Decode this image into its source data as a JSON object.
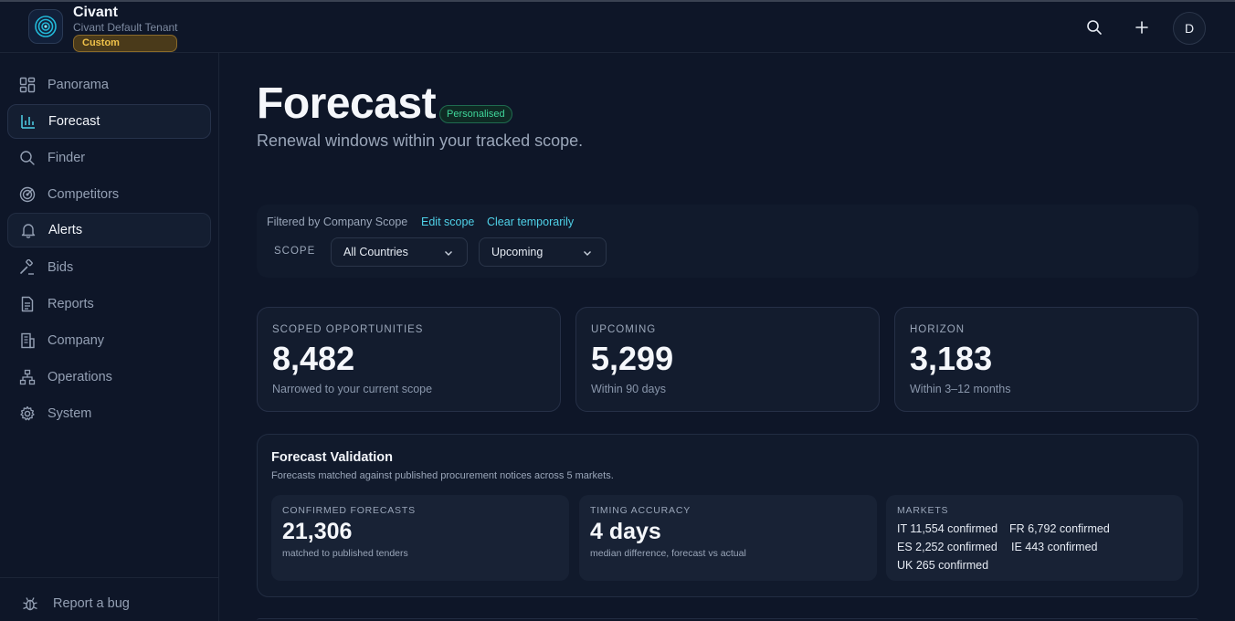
{
  "brand": {
    "name": "Civant",
    "tenant": "Civant Default Tenant",
    "badge": "Custom"
  },
  "header": {
    "avatar_initial": "D",
    "search_icon": "search-icon",
    "add_icon": "plus-icon"
  },
  "sidebar": {
    "items": [
      {
        "label": "Panorama",
        "icon": "grid-icon"
      },
      {
        "label": "Forecast",
        "icon": "bar-chart-icon",
        "active": true
      },
      {
        "label": "Finder",
        "icon": "search-icon"
      },
      {
        "label": "Competitors",
        "icon": "target-icon"
      },
      {
        "label": "Alerts",
        "icon": "bell-icon"
      },
      {
        "label": "Bids",
        "icon": "gavel-icon"
      },
      {
        "label": "Reports",
        "icon": "document-icon"
      },
      {
        "label": "Company",
        "icon": "building-icon"
      },
      {
        "label": "Operations",
        "icon": "org-chart-icon"
      },
      {
        "label": "System",
        "icon": "gear-icon"
      }
    ],
    "report_bug": "Report a bug"
  },
  "page": {
    "title": "Forecast",
    "badge": "Personalised",
    "subtitle": "Renewal windows within your tracked scope."
  },
  "filters": {
    "filtered_by": "Filtered by Company Scope",
    "edit_scope": "Edit scope",
    "clear_temporarily": "Clear temporarily",
    "scope_label": "SCOPE",
    "country_select": "All Countries",
    "window_select": "Upcoming"
  },
  "stats": [
    {
      "label": "SCOPED OPPORTUNITIES",
      "value": "8,482",
      "caption": "Narrowed to your current scope"
    },
    {
      "label": "UPCOMING",
      "value": "5,299",
      "caption": "Within 90 days"
    },
    {
      "label": "HORIZON",
      "value": "3,183",
      "caption": "Within 3–12 months"
    }
  ],
  "validation": {
    "title": "Forecast Validation",
    "subtitle": "Forecasts matched against published procurement notices across 5 markets.",
    "confirmed": {
      "label": "CONFIRMED FORECASTS",
      "value": "21,306",
      "caption": "matched to published tenders"
    },
    "timing": {
      "label": "TIMING ACCURACY",
      "value": "4 days",
      "caption": "median difference, forecast vs actual"
    },
    "markets": {
      "label": "MARKETS",
      "items": [
        "IT 11,554 confirmed",
        "FR 6,792 confirmed",
        "ES 2,252 confirmed",
        "IE 443 confirmed",
        "UK 265 confirmed"
      ]
    }
  },
  "colors": {
    "background": "#0e1628",
    "accent": "#4fd1e8",
    "badge_green": "#3fd69a",
    "badge_gold": "#f0c24a"
  }
}
